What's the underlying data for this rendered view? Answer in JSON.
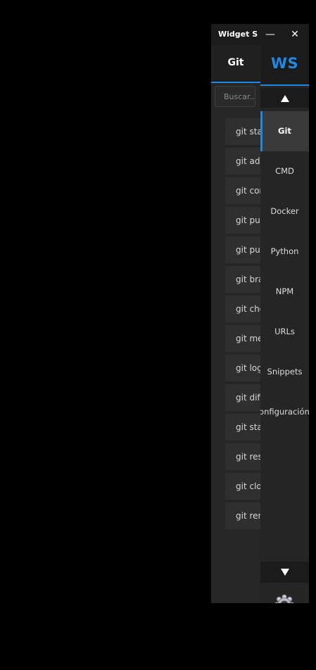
{
  "window": {
    "title": "Widget Sidebar",
    "minimize_glyph": "—",
    "close_glyph": "✕"
  },
  "left": {
    "category_title": "Git",
    "search": {
      "placeholder": "Buscar...",
      "value": ""
    },
    "commands": [
      "git status",
      "git add",
      "git commit",
      "git push",
      "git pull",
      "git branch",
      "git checkout",
      "git merge",
      "git log",
      "git diff",
      "git stash",
      "git reset",
      "git clone",
      "git remote"
    ]
  },
  "right": {
    "logo": "WS",
    "nav_items": [
      "Git",
      "CMD",
      "Docker",
      "Python",
      "NPM",
      "URLs",
      "Snippets",
      "Configuración"
    ],
    "active_index": 0,
    "icons": {
      "scroll_up": "triangle-up-icon",
      "scroll_down": "triangle-down-icon",
      "settings": "gear-icon"
    }
  },
  "colors": {
    "accent": "#1e88e5",
    "background": "#262626",
    "titlebar": "#1b1b1b"
  }
}
